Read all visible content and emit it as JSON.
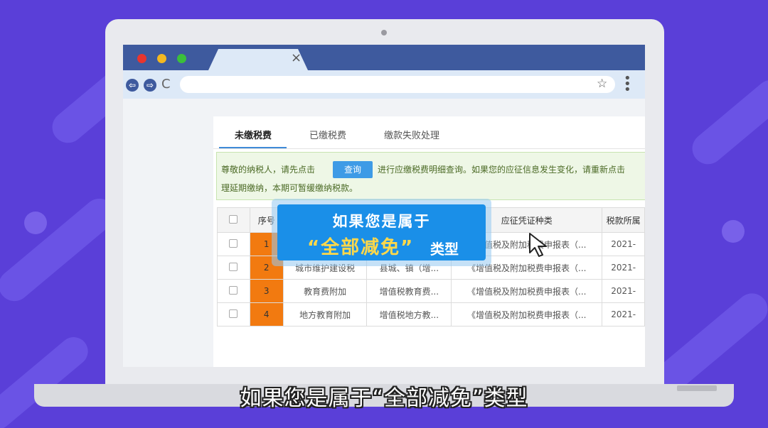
{
  "browser": {
    "tab_close": "×",
    "url": "",
    "nav_back": "⇦",
    "nav_forward": "⇨",
    "reload": "C",
    "star": "☆",
    "menu": "⋮"
  },
  "tabs": [
    {
      "label": "未缴税费",
      "active": true
    },
    {
      "label": "已缴税费",
      "active": false
    },
    {
      "label": "缴款失败处理",
      "active": false
    }
  ],
  "notice": {
    "line1_prefix": "尊敬的纳税人，请先点击",
    "query_button": "查询",
    "line1_suffix": "进行应缴税费明细查询。如果您的应征信息发生变化，请重新点击",
    "line2": "理延期缴纳，本期可暂缓缴纳税款。"
  },
  "table": {
    "headers": [
      "",
      "序号",
      "",
      "",
      "应征凭证种类",
      "税款所属"
    ],
    "rows": [
      {
        "num": "1",
        "col3": "",
        "col4": "",
        "col5": "《增值税及附加税费申报表（...",
        "col6": "2021-"
      },
      {
        "num": "2",
        "col3": "城市维护建设税",
        "col4": "县城、镇（增...",
        "col5": "《增值税及附加税费申报表（...",
        "col6": "2021-"
      },
      {
        "num": "3",
        "col3": "教育费附加",
        "col4": "增值税教育费...",
        "col5": "《增值税及附加税费申报表（...",
        "col6": "2021-"
      },
      {
        "num": "4",
        "col3": "地方教育附加",
        "col4": "增值税地方教...",
        "col5": "《增值税及附加税费申报表（...",
        "col6": "2021-"
      }
    ]
  },
  "overlay": {
    "line1": "如果您是属于",
    "line2": "“全部减免”",
    "line3": "类型"
  },
  "subtitle": "如果您是属于“全部减免”类型",
  "colors": {
    "background": "#5a3fd8",
    "tabbar": "#3e5a9e",
    "accent": "#1a8fe8",
    "highlight": "#ffd84a",
    "row_number": "#f27a10"
  }
}
